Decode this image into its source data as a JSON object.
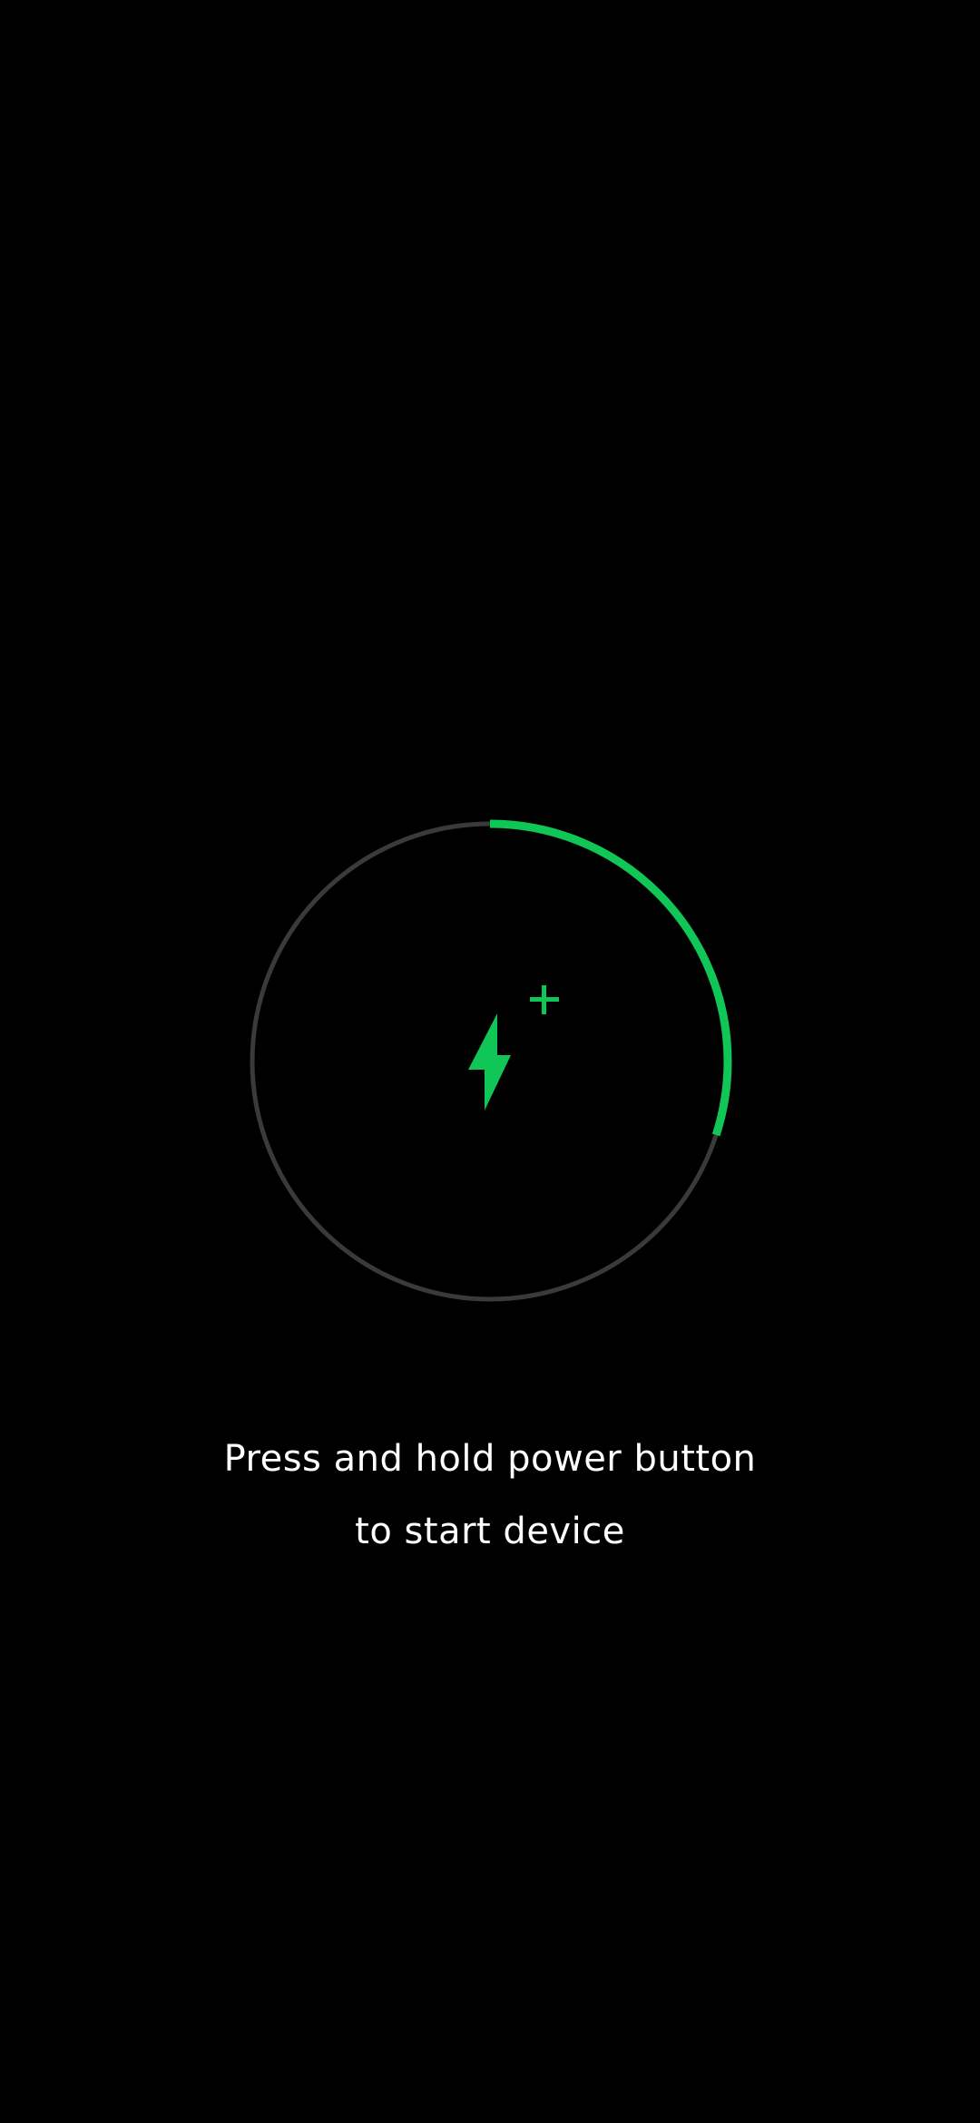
{
  "charging": {
    "level_fraction": 0.3,
    "accent_color": "#10C656",
    "track_color": "#3A3A3A",
    "icon": "lightning-bolt-icon",
    "indicator_icon": "plus-icon"
  },
  "message": {
    "line1": "Press and hold power button",
    "line2": "to start device"
  }
}
